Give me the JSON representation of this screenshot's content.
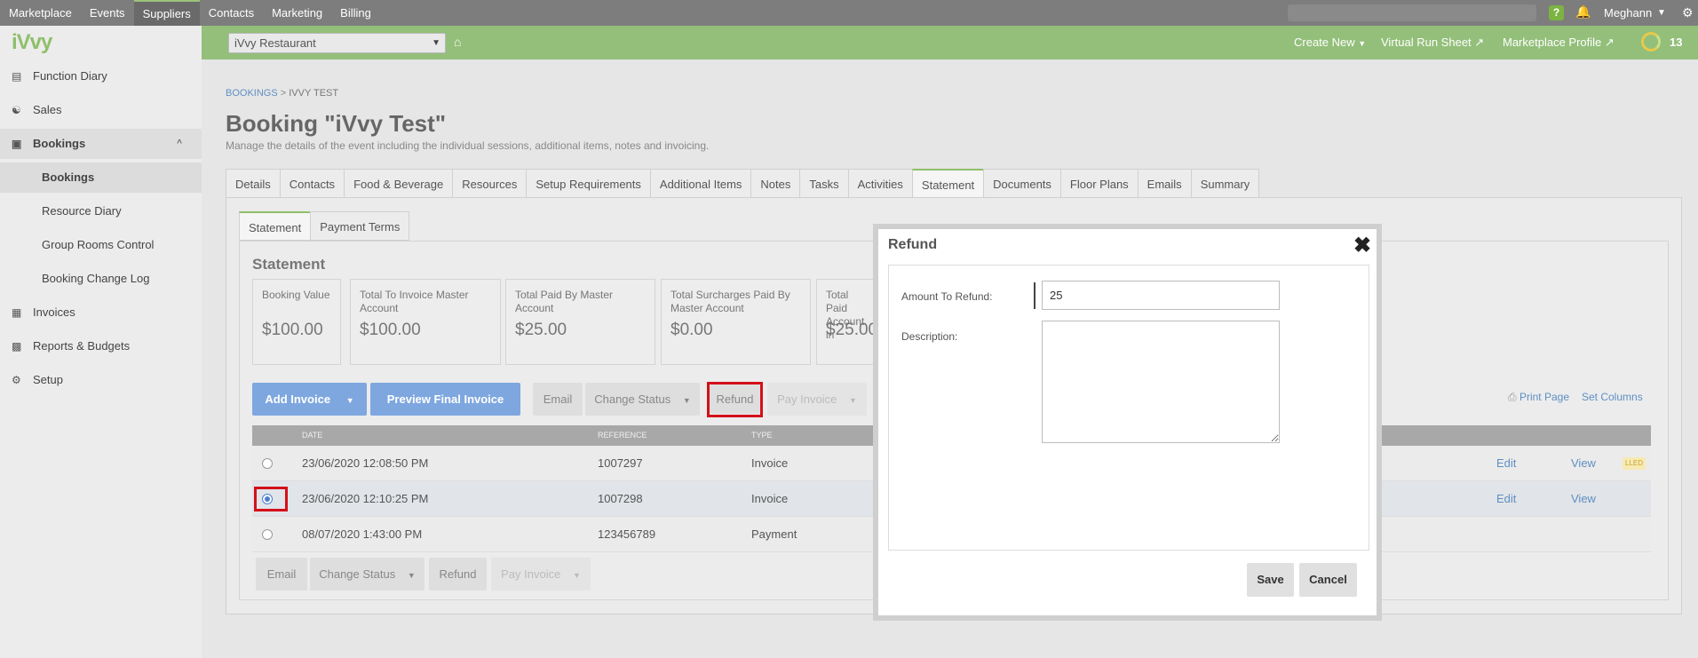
{
  "topnav": {
    "items": [
      "Marketplace",
      "Events",
      "Suppliers",
      "Contacts",
      "Marketing",
      "Billing"
    ],
    "help": "?",
    "user": "Meghann"
  },
  "greenbar": {
    "venue": "iVvy Restaurant",
    "create_new": "Create New",
    "virtual_run_sheet": "Virtual Run Sheet",
    "marketplace_profile": "Marketplace Profile",
    "notification_count": "13"
  },
  "sidebar": {
    "logo": "iVvy",
    "items": {
      "function_diary": "Function Diary",
      "sales": "Sales",
      "bookings": "Bookings",
      "bookings_sub": "Bookings",
      "resource_diary": "Resource Diary",
      "group_rooms": "Group Rooms Control",
      "change_log": "Booking Change Log",
      "invoices": "Invoices",
      "reports": "Reports & Budgets",
      "setup": "Setup"
    }
  },
  "breadcrumb": {
    "root": "BOOKINGS",
    "sep": ">",
    "current": "IVVY TEST"
  },
  "page": {
    "title": "Booking \"iVvy Test\"",
    "subtitle": "Manage the details of the event including the individual sessions, additional items, notes and invoicing."
  },
  "tabs": [
    "Details",
    "Contacts",
    "Food & Beverage",
    "Resources",
    "Setup Requirements",
    "Additional Items",
    "Notes",
    "Tasks",
    "Activities",
    "Statement",
    "Documents",
    "Floor Plans",
    "Emails",
    "Summary"
  ],
  "subtabs": [
    "Statement",
    "Payment Terms"
  ],
  "statement": {
    "title": "Statement",
    "stats": [
      {
        "label": "Booking Value",
        "value": "$100.00"
      },
      {
        "label": "Total To Invoice Master Account",
        "value": "$100.00"
      },
      {
        "label": "Total Paid By Master Account",
        "value": "$25.00"
      },
      {
        "label": "Total Surcharges Paid By Master Account",
        "value": "$0.00"
      },
      {
        "label": "Total Paid Account in",
        "value": "$25.00"
      }
    ]
  },
  "toolbar": {
    "add_invoice": "Add Invoice",
    "preview": "Preview Final Invoice",
    "email": "Email",
    "change_status": "Change Status",
    "refund": "Refund",
    "pay_invoice": "Pay Invoice",
    "print_page": "Print Page",
    "set_columns": "Set Columns"
  },
  "table": {
    "headers": {
      "date": "DATE",
      "reference": "REFERENCE",
      "type": "TYPE"
    },
    "rows": [
      {
        "date": "23/06/2020 12:08:50 PM",
        "reference": "1007297",
        "type": "Invoice",
        "badge": "LLED",
        "edit": "Edit",
        "view": "View"
      },
      {
        "date": "23/06/2020 12:10:25 PM",
        "reference": "1007298",
        "type": "Invoice",
        "edit": "Edit",
        "view": "View"
      },
      {
        "date": "08/07/2020 1:43:00 PM",
        "reference": "123456789",
        "type": "Payment"
      }
    ]
  },
  "modal": {
    "title": "Refund",
    "amount_label": "Amount To Refund:",
    "amount_value": "25",
    "description_label": "Description:",
    "save": "Save",
    "cancel": "Cancel"
  }
}
